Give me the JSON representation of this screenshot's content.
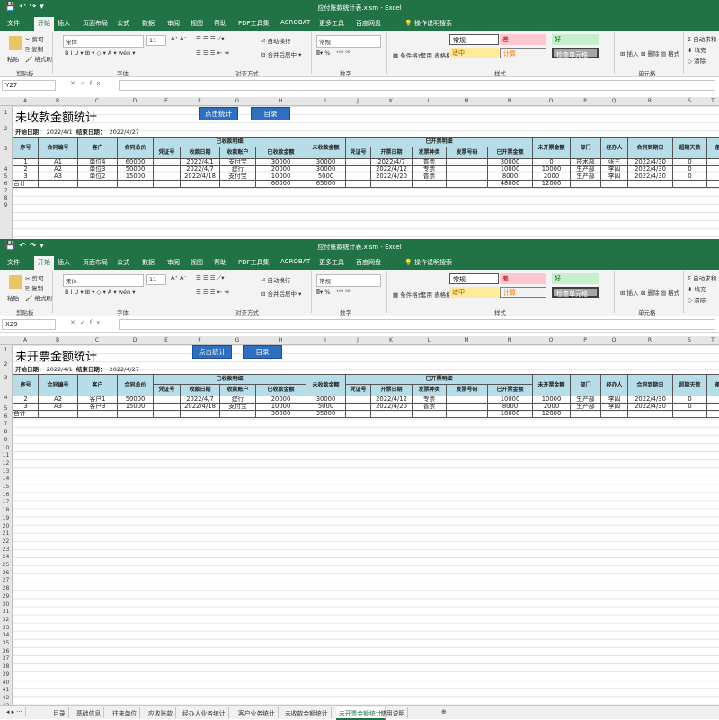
{
  "app": {
    "title1": "应付账款统计表.xlsm  -  Excel",
    "title2": "应付账款统计表.xlsm  -  Excel"
  },
  "menu": [
    "文件",
    "开始",
    "插入",
    "页面布局",
    "公式",
    "数据",
    "审阅",
    "视图",
    "帮助",
    "PDF工具集",
    "ACROBAT",
    "更多工具",
    "百度网盘",
    "操作说明搜索"
  ],
  "ribbon": {
    "paste": "粘贴",
    "cut": "剪切",
    "copy": "复制",
    "format_painter": "格式刷",
    "clipboard": "剪贴板",
    "font_name": "宋体",
    "font_size": "11",
    "font": "字体",
    "wrap": "自动换行",
    "merge": "合并后居中",
    "align": "对齐方式",
    "num_format": "常规",
    "number": "数字",
    "cond": "条件格式",
    "table_fmt": "套用\n表格格式",
    "styles": "样式",
    "s_normal": "常规",
    "s_bad": "差",
    "s_good": "好",
    "s_neutral": "适中",
    "s_calc": "计算",
    "s_check": "检查单元格",
    "insert": "插入",
    "delete": "删除",
    "format": "格式",
    "cells": "单元格",
    "autosum": "自动求和",
    "fill": "填充",
    "clear": "清除"
  },
  "namebox1": "Y27",
  "namebox2": "X29",
  "cols": [
    "A",
    "B",
    "C",
    "D",
    "E",
    "F",
    "G",
    "H",
    "I",
    "J",
    "K",
    "L",
    "M",
    "N",
    "O",
    "P",
    "Q",
    "R",
    "S",
    "T"
  ],
  "sheet1": {
    "title": "未收款金额统计",
    "start_label": "开始日期：",
    "start": "2022/4/1",
    "end_label": "结束日期：",
    "end": "2022/4/27",
    "btn_stat": "点击统计",
    "btn_toc": "目录",
    "grp_received": "已收款明细",
    "grp_invoiced": "已开票明细",
    "headers": [
      "序号",
      "合同编号",
      "客户",
      "合同总价",
      "凭证号",
      "收款日期",
      "收款账户",
      "已收款金额",
      "未收款金额",
      "凭证号",
      "开票日期",
      "发票种类",
      "发票号码",
      "已开票金额",
      "未开票金额",
      "部门",
      "经办人",
      "合同到期日",
      "超期天数",
      "备注"
    ],
    "rows": [
      [
        "1",
        "A1",
        "单位4",
        "60000",
        "",
        "2022/4/1",
        "支付宝",
        "30000",
        "30000",
        "",
        "2022/4/7",
        "普票",
        "",
        "30000",
        "0",
        "技术部",
        "张三",
        "2022/4/30",
        "0",
        ""
      ],
      [
        "2",
        "A2",
        "单位3",
        "50000",
        "",
        "2022/4/7",
        "建行",
        "20000",
        "30000",
        "",
        "2022/4/12",
        "专票",
        "",
        "10000",
        "10000",
        "生产部",
        "李四",
        "2022/4/30",
        "0",
        ""
      ],
      [
        "3",
        "A3",
        "单位2",
        "15000",
        "",
        "2022/4/18",
        "支付宝",
        "10000",
        "5000",
        "",
        "2022/4/20",
        "普票",
        "",
        "8000",
        "2000",
        "生产部",
        "李四",
        "2022/4/30",
        "0",
        ""
      ]
    ],
    "total": [
      "合计",
      "",
      "",
      "",
      "",
      "",
      "",
      "60000",
      "65000",
      "",
      "",
      "",
      "",
      "48000",
      "12000",
      "",
      "",
      "",
      "",
      ""
    ]
  },
  "sheet2": {
    "title": "未开票金额统计",
    "start_label": "开始日期：",
    "start": "2022/4/1",
    "end_label": "结束日期：",
    "end": "2022/4/27",
    "btn_stat": "点击统计",
    "btn_toc": "目录",
    "grp_received": "已收款明细",
    "grp_invoiced": "已开票明细",
    "headers": [
      "序号",
      "合同编号",
      "客户",
      "合同总价",
      "凭证号",
      "收款日期",
      "收款账户",
      "已收款金额",
      "未收款金额",
      "凭证号",
      "开票日期",
      "发票种类",
      "发票号码",
      "已开票金额",
      "未开票金额",
      "部门",
      "经办人",
      "合同到期日",
      "超期天数",
      "备注"
    ],
    "rows": [
      [
        "2",
        "A2",
        "客户1",
        "50000",
        "",
        "2022/4/7",
        "建行",
        "20000",
        "30000",
        "",
        "2022/4/12",
        "专票",
        "",
        "10000",
        "10000",
        "生产部",
        "李四",
        "2022/4/30",
        "0",
        ""
      ],
      [
        "3",
        "A3",
        "客户3",
        "15000",
        "",
        "2022/4/18",
        "支付宝",
        "10000",
        "5000",
        "",
        "2022/4/20",
        "普票",
        "",
        "8000",
        "2000",
        "生产部",
        "李四",
        "2022/4/30",
        "0",
        ""
      ]
    ],
    "total": [
      "合计",
      "",
      "",
      "",
      "",
      "",
      "",
      "30000",
      "35000",
      "",
      "",
      "",
      "",
      "18000",
      "12000",
      "",
      "",
      "",
      "",
      ""
    ]
  },
  "tabs": [
    "目录",
    "基础信息",
    "往来单位",
    "应收账款",
    "经办人业务统计",
    "客户业务统计",
    "未收款金额统计",
    "未开票金额统计",
    "使用说明"
  ],
  "active_tab": "未开票金额统计",
  "colors": {
    "excel_green": "#217346",
    "header_fill": "#b7dde8",
    "button": "#2e6fbf"
  }
}
